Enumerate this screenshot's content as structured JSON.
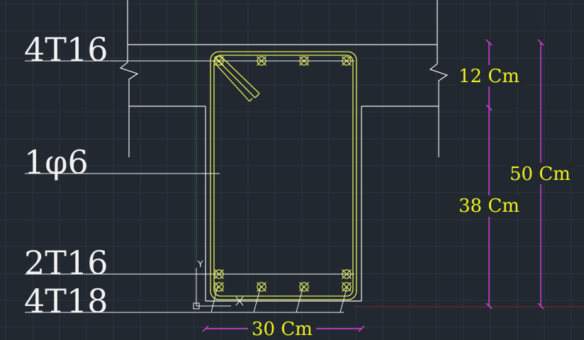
{
  "labels": {
    "top_bars": "4T16",
    "stirrup": "1φ6",
    "mid_bars": "2T16",
    "bottom_bars": "4T18"
  },
  "dimensions": {
    "top": "12 Cm",
    "middle": "38 Cm",
    "total": "50 Cm",
    "width": "30 Cm"
  },
  "ucs": {
    "y_axis": "Y"
  },
  "colors": {
    "background": "#212830",
    "grid": "#2d3440",
    "linework": "#f2f2f2",
    "rebar": "#e8ef60",
    "dimension": "#e040e8",
    "text_dim": "#f0f020",
    "axis_red": "#7a2b2b",
    "axis_green": "#2f6b2f"
  }
}
